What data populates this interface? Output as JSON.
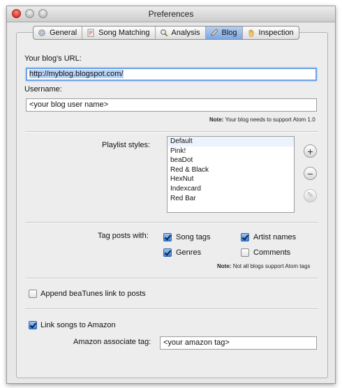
{
  "window": {
    "title": "Preferences"
  },
  "tabs": [
    {
      "label": "General",
      "icon": "gear-icon"
    },
    {
      "label": "Song Matching",
      "icon": "document-icon"
    },
    {
      "label": "Analysis",
      "icon": "magnifier-icon"
    },
    {
      "label": "Blog",
      "icon": "pen-icon",
      "active": true
    },
    {
      "label": "Inspection",
      "icon": "hand-icon"
    }
  ],
  "blog": {
    "url_label": "Your blog's URL:",
    "url_value": "http://myblog.blogspot.com/",
    "username_label": "Username:",
    "username_value": "<your blog user name>",
    "note_bold": "Note:",
    "note_text": "Your blog needs to support Atom 1.0"
  },
  "playlist": {
    "label": "Playlist styles:",
    "items": [
      "Default",
      "Pink!",
      "beaDot",
      "Red & Black",
      "HexNut",
      "Indexcard",
      "Red Bar"
    ],
    "add_icon": "plus-icon",
    "remove_icon": "minus-icon",
    "edit_icon": "edit-icon"
  },
  "tags": {
    "label": "Tag posts with:",
    "song_tags": {
      "label": "Song tags",
      "checked": true
    },
    "artist_names": {
      "label": "Artist names",
      "checked": true
    },
    "genres": {
      "label": "Genres",
      "checked": true
    },
    "comments": {
      "label": "Comments",
      "checked": false
    },
    "note_bold": "Note:",
    "note_text": "Not all blogs support Atom tags"
  },
  "append": {
    "label": "Append beaTunes link to posts",
    "checked": false
  },
  "amazon": {
    "link_label": "Link songs to Amazon",
    "link_checked": true,
    "tag_label": "Amazon associate tag:",
    "tag_value": "<your amazon tag>"
  },
  "colors": {
    "accent": "#3b7fd6",
    "focus": "#6fa4e8",
    "selection": "#b8d3f7"
  }
}
